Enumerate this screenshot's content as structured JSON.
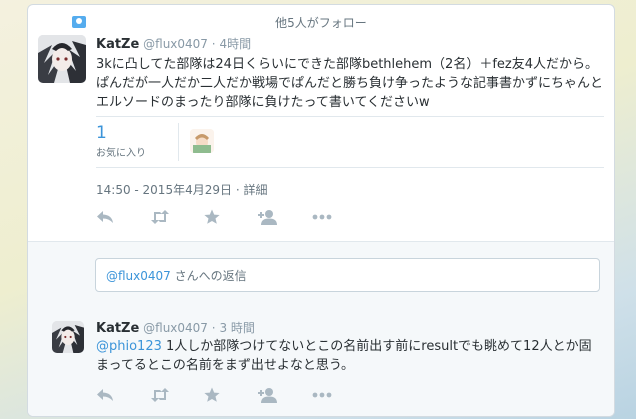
{
  "follow_note": "他5人がフォロー",
  "tweet": {
    "name": "KatZe",
    "handle": "@flux0407",
    "time": "4時間",
    "text": "3kに凸してた部隊は24日くらいにできた部隊bethlehem（2名）＋fez友4人だから。ぱんだが一人だか二人だか戦場でぱんだと勝ち負け争ったような記事書かずにちゃんとエルソードのまったり部隊に負けたって書いてくださいw",
    "favorites_count": "1",
    "favorites_label": "お気に入り",
    "timestamp": "14:50 - 2015年4月29日",
    "details_link": "詳細",
    "separator": "·"
  },
  "reply_box": {
    "mention": "@flux0407",
    "suffix": " さんへの返信"
  },
  "reply": {
    "name": "KatZe",
    "handle": "@flux0407",
    "time": "3 時間",
    "mention": "@phio123",
    "text": " 1人しか部隊つけてないとこの名前出す前にresultでも眺めて12人とか固まってるとこの名前をまず出せよなと思う。"
  },
  "actions": [
    {
      "name": "reply",
      "icon": "reply-icon"
    },
    {
      "name": "retweet",
      "icon": "retweet-icon"
    },
    {
      "name": "favorite",
      "icon": "star-icon"
    },
    {
      "name": "follow",
      "icon": "add-user-icon"
    },
    {
      "name": "more",
      "icon": "more-icon"
    }
  ],
  "colors": {
    "link": "#3b94d9",
    "action_icon": "#aab8c2",
    "text": "#292f33",
    "muted": "#8899a6"
  }
}
